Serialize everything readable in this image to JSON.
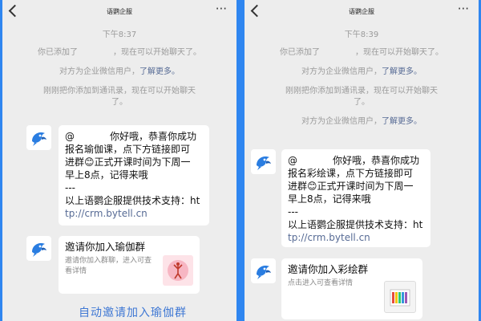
{
  "left": {
    "title": "语鹦企服",
    "time": "下午8:37",
    "sys_added_prefix": "你已添加了",
    "sys_added_suffix": "，现在可以开始聊天了。",
    "sys_enterprise_prefix": "对方为企业微信用户，",
    "sys_enterprise_link": "了解更多。",
    "sys_contacts": "刚刚把你添加到通讯录，现在可以开始聊天了。",
    "message": {
      "at": "@",
      "line1_rest": "你好哦，恭喜你成功",
      "line2": "报名瑜伽课，点下方链接即可",
      "line3": "进群😊正式开课时间为下周一",
      "line4": "早上8点，记得来哦",
      "sep": "---",
      "line5": "以上语鹦企服提供技术支持：ht",
      "line6": "tp://crm.bytell.cn"
    },
    "card": {
      "title": "邀请你加入瑜伽群",
      "desc": "邀请你加入群聊，进入可查看详情"
    },
    "footer_link": "自动邀请加入瑜伽群"
  },
  "right": {
    "title": "语鹦企服",
    "time": "下午8:39",
    "sys_added_prefix": "你已添加了",
    "sys_added_suffix": "，现在可以开始聊天了。",
    "sys_enterprise_prefix": "对方为企业微信用户，",
    "sys_enterprise_link": "了解更多。",
    "sys_contacts": "刚刚把你添加到通讯录，现在可以开始聊天了。",
    "sys_enterprise2_prefix": "对方为企业微信用户，",
    "sys_enterprise2_link": "了解更多。",
    "message": {
      "at": "@",
      "line1_rest": "你好哦，恭喜你成功",
      "line2": "报名彩绘课，点下方链接即可",
      "line3": "进群😊正式开课时间为下周一",
      "line4": "早上8点，记得来哦",
      "sep": "---",
      "line5": "以上语鹦企服提供技术支持：ht",
      "line6": "tp://crm.bytell.cn"
    },
    "card": {
      "title": "邀请你加入彩绘群",
      "desc": "点击进入可查看详情"
    }
  },
  "icons": {
    "back": "back-arrow-icon",
    "more": "more-icon",
    "avatar": "parrot-logo-icon"
  },
  "colors": {
    "background": "#2f86f0",
    "link": "#576b95",
    "footer_link": "#3f78d4"
  }
}
